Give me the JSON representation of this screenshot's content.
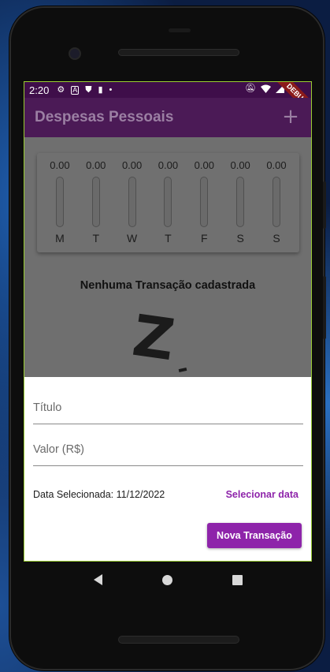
{
  "status_bar": {
    "time": "2:20",
    "left_icons": [
      "gear-icon",
      "a-icon",
      "shield-icon",
      "sim-icon",
      "dot-icon"
    ],
    "right_icons": [
      "mute-icon",
      "wifi-icon",
      "signal-icon"
    ],
    "debug_label": "DEBUG"
  },
  "app_bar": {
    "title": "Despesas Pessoais",
    "add_icon": "plus-icon"
  },
  "chart": {
    "days": [
      {
        "label": "M",
        "value": "0.00",
        "fill": 0
      },
      {
        "label": "T",
        "value": "0.00",
        "fill": 0
      },
      {
        "label": "W",
        "value": "0.00",
        "fill": 0
      },
      {
        "label": "T",
        "value": "0.00",
        "fill": 0
      },
      {
        "label": "F",
        "value": "0.00",
        "fill": 0
      },
      {
        "label": "S",
        "value": "0.00",
        "fill": 0
      },
      {
        "label": "S",
        "value": "0.00",
        "fill": 0
      }
    ]
  },
  "empty_state": {
    "title": "Nenhuma Transação cadastrada",
    "image_icon": "sleeping-z-icon"
  },
  "form": {
    "title_placeholder": "Título",
    "title_value": "",
    "value_placeholder": "Valor (R$)",
    "value_value": "",
    "date_label": "Data Selecionada: 11/12/2022",
    "select_date_label": "Selecionar data",
    "submit_label": "Nova Transação"
  },
  "nav_bar": {
    "back_icon": "back-icon",
    "home_icon": "home-icon",
    "recents_icon": "recents-icon"
  },
  "colors": {
    "primary": "#8e24aa",
    "app_bar_dimmed": "#4b1a56",
    "status_bar": "#3f0e4a"
  }
}
